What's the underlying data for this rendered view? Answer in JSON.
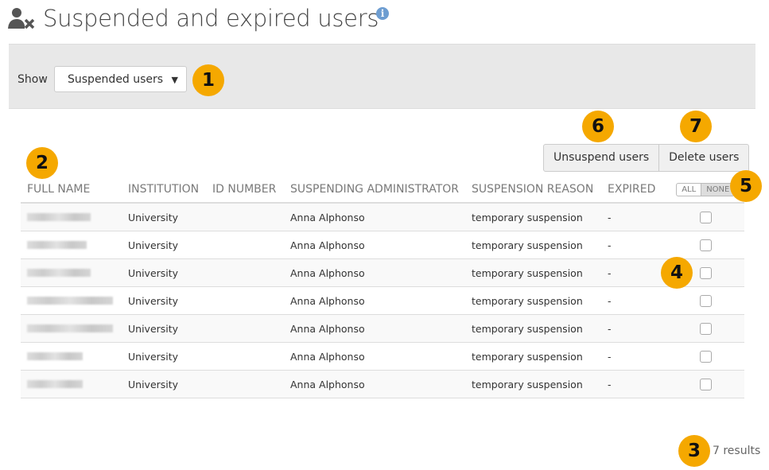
{
  "page": {
    "title": "Suspended and expired users"
  },
  "filter": {
    "label": "Show",
    "selected": "Suspended users"
  },
  "actions": {
    "unsuspend": "Unsuspend users",
    "delete": "Delete users"
  },
  "table": {
    "headers": [
      "FULL NAME",
      "INSTITUTION",
      "ID NUMBER",
      "SUSPENDING ADMINISTRATOR",
      "SUSPENSION REASON",
      "EXPIRED"
    ],
    "select_all": "ALL",
    "select_none": "NONE",
    "rows": [
      {
        "institution": "University",
        "id": "",
        "admin": "Anna Alphonso",
        "reason": "temporary suspension",
        "expired": "-"
      },
      {
        "institution": "University",
        "id": "",
        "admin": "Anna Alphonso",
        "reason": "temporary suspension",
        "expired": "-"
      },
      {
        "institution": "University",
        "id": "",
        "admin": "Anna Alphonso",
        "reason": "temporary suspension",
        "expired": "-"
      },
      {
        "institution": "University",
        "id": "",
        "admin": "Anna Alphonso",
        "reason": "temporary suspension",
        "expired": "-"
      },
      {
        "institution": "University",
        "id": "",
        "admin": "Anna Alphonso",
        "reason": "temporary suspension",
        "expired": "-"
      },
      {
        "institution": "University",
        "id": "",
        "admin": "Anna Alphonso",
        "reason": "temporary suspension",
        "expired": "-"
      },
      {
        "institution": "University",
        "id": "",
        "admin": "Anna Alphonso",
        "reason": "temporary suspension",
        "expired": "-"
      }
    ]
  },
  "results": "7 results",
  "callouts": [
    "1",
    "2",
    "3",
    "4",
    "5",
    "6",
    "7"
  ],
  "colors": {
    "callout": "#f5a800",
    "filter_bg": "#e8e8e8"
  }
}
